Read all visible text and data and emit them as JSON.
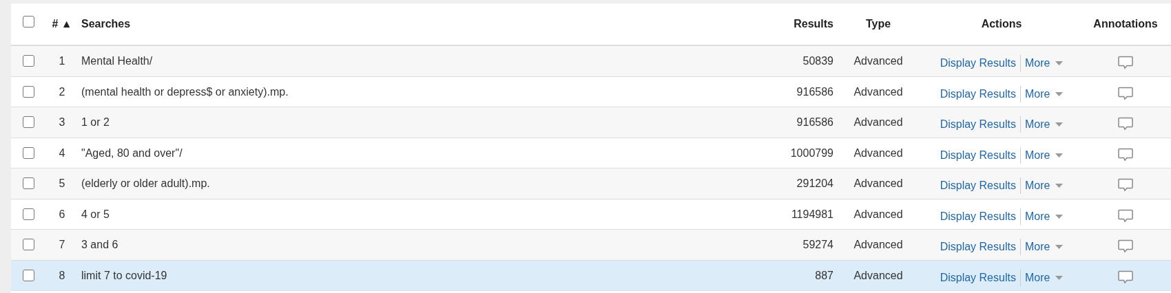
{
  "table": {
    "select_all": {
      "checked": false
    },
    "columns": [
      "# ▲",
      "Searches",
      "Results",
      "Type",
      "Actions",
      "Annotations"
    ],
    "rows": [
      {
        "checked": false,
        "selected": false,
        "number": "1",
        "search": "Mental Health/",
        "results": "50839",
        "type": "Advanced",
        "display": "Display Results",
        "more": "More"
      },
      {
        "checked": false,
        "selected": false,
        "number": "2",
        "search": "(mental health or depress$ or anxiety).mp.",
        "results": "916586",
        "type": "Advanced",
        "display": "Display Results",
        "more": "More"
      },
      {
        "checked": false,
        "selected": false,
        "number": "3",
        "search": "1 or 2",
        "results": "916586",
        "type": "Advanced",
        "display": "Display Results",
        "more": "More"
      },
      {
        "checked": false,
        "selected": false,
        "number": "4",
        "search": "\"Aged, 80 and over\"/",
        "results": "1000799",
        "type": "Advanced",
        "display": "Display Results",
        "more": "More"
      },
      {
        "checked": false,
        "selected": false,
        "number": "5",
        "search": "(elderly or older adult).mp.",
        "results": "291204",
        "type": "Advanced",
        "display": "Display Results",
        "more": "More"
      },
      {
        "checked": false,
        "selected": false,
        "number": "6",
        "search": "4 or 5",
        "results": "1194981",
        "type": "Advanced",
        "display": "Display Results",
        "more": "More"
      },
      {
        "checked": false,
        "selected": false,
        "number": "7",
        "search": "3 and 6",
        "results": "59274",
        "type": "Advanced",
        "display": "Display Results",
        "more": "More"
      },
      {
        "checked": false,
        "selected": true,
        "number": "8",
        "search": "limit 7 to covid-19",
        "results": "887",
        "type": "Advanced",
        "display": "Display Results",
        "more": "More"
      }
    ]
  }
}
